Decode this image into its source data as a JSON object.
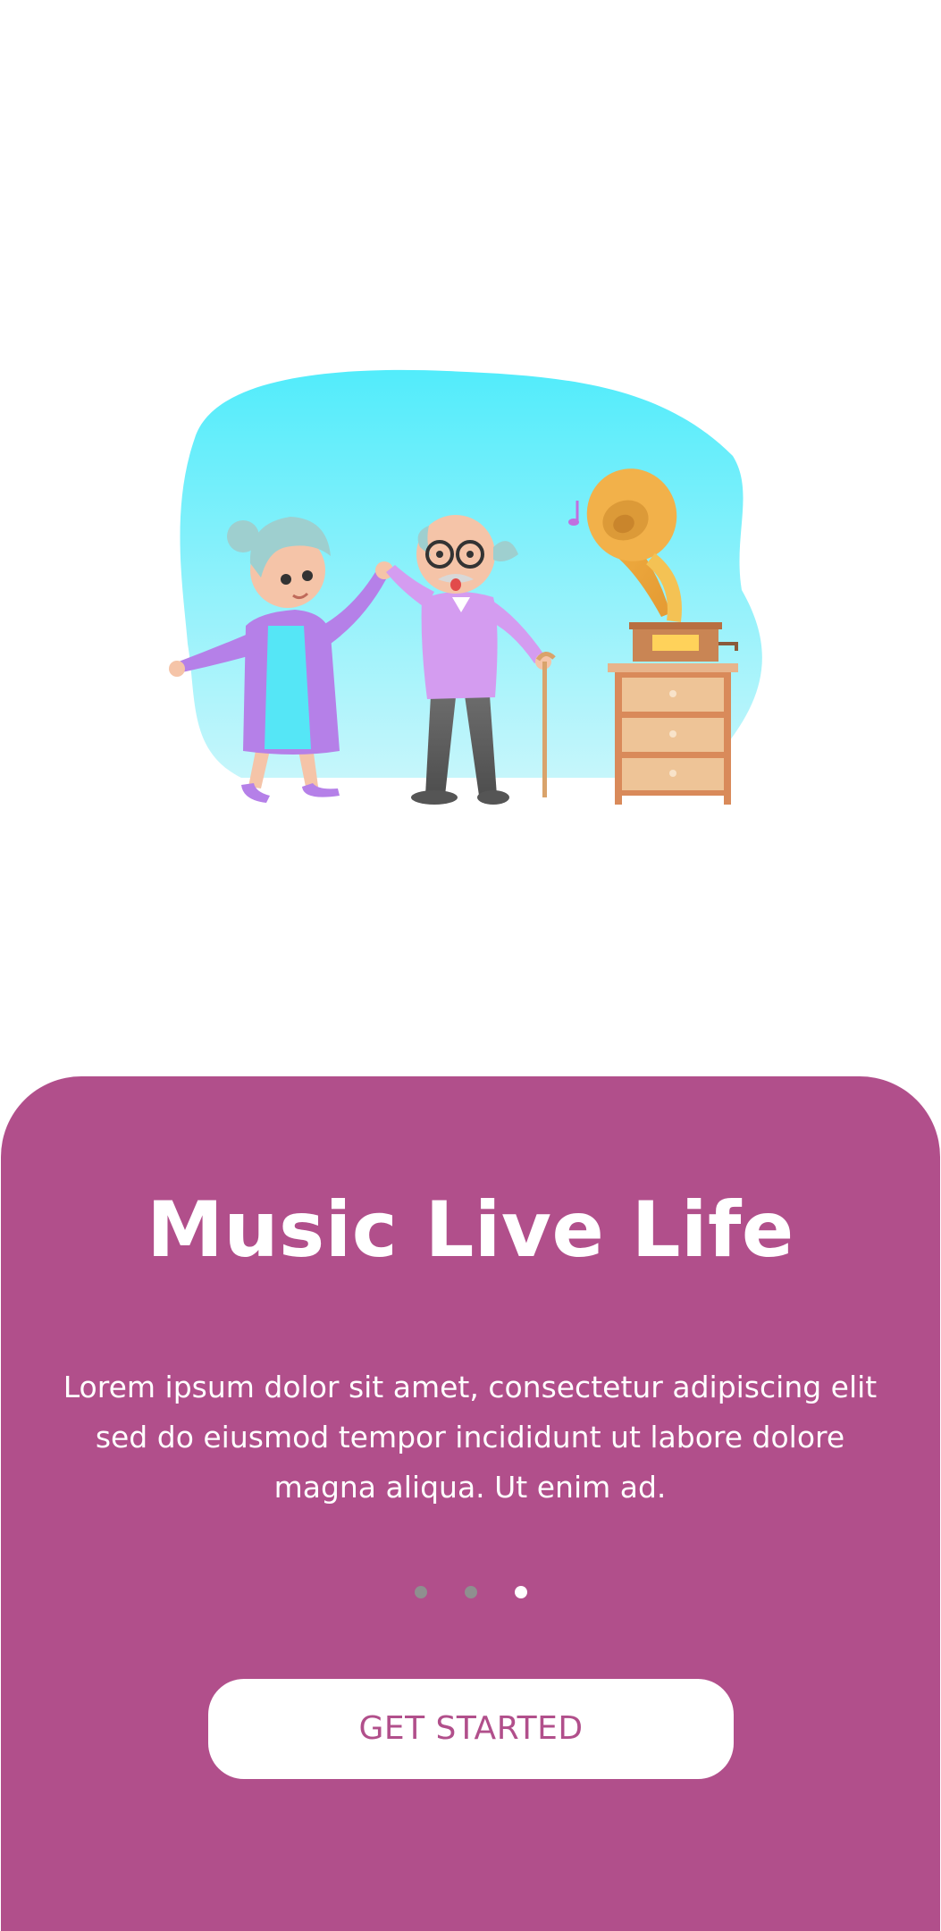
{
  "onboarding": {
    "illustration_icon": "elderly-couple-dancing-gramophone-illustration",
    "title": "Music Live Life",
    "description": "Lorem ipsum dolor sit amet, consectetur adipiscing elit sed do eiusmod tempor incididunt ut labore dolore magna aliqua. Ut enim ad.",
    "pagination": {
      "total": 3,
      "active_index": 2
    },
    "cta_label": "GET STARTED"
  },
  "colors": {
    "panel_background": "#b14f8b",
    "button_background": "#ffffff",
    "button_text": "#b14f8b",
    "dot_inactive": "#8f8f8f",
    "dot_active": "#ffffff",
    "blob_top": "#55ecfb",
    "blob_bottom": "#c8f6fb"
  }
}
